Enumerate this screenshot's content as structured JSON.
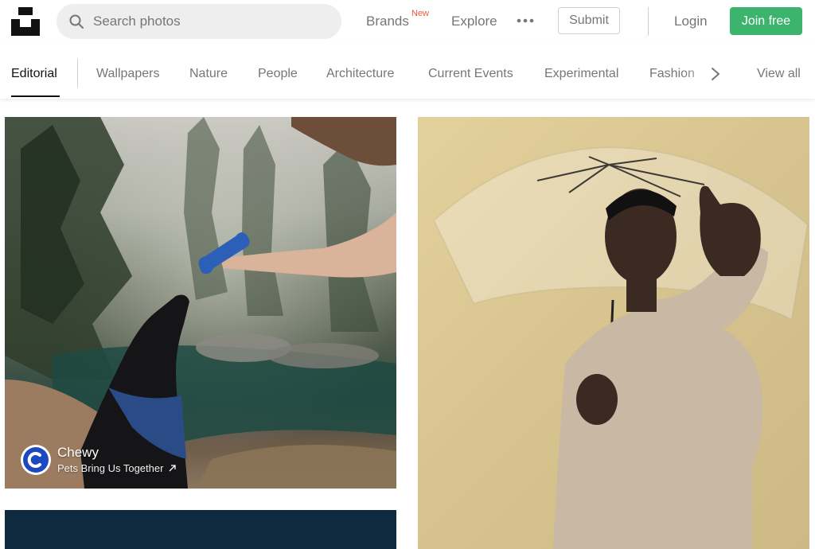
{
  "header": {
    "logo_icon": "unsplash-logo-icon",
    "search": {
      "placeholder": "Search photos",
      "icon": "search-icon"
    },
    "nav": {
      "brands": "Brands",
      "brands_badge": "New",
      "explore": "Explore",
      "more_icon": "more-dots-icon",
      "submit": "Submit",
      "login": "Login",
      "join": "Join free"
    },
    "colors": {
      "join_bg": "#3cb46e",
      "badge": "#e25c3d"
    }
  },
  "categories": {
    "items": [
      {
        "label": "Editorial",
        "active": true
      },
      {
        "label": "Wallpapers"
      },
      {
        "label": "Nature"
      },
      {
        "label": "People"
      },
      {
        "label": "Architecture"
      },
      {
        "label": "Current Events"
      },
      {
        "label": "Experimental"
      },
      {
        "label": "Fashion"
      }
    ],
    "next_icon": "chevron-right-icon",
    "view_all": "View all"
  },
  "photos": {
    "dog": {
      "subject": "dog-and-hand-with-toy-photo",
      "sponsor": {
        "name": "Chewy",
        "tagline": "Pets Bring Us Together",
        "avatar_letter": "C",
        "avatar_color": "#1c49c2",
        "link_icon": "external-arrow-icon"
      }
    },
    "man": {
      "subject": "man-with-clear-umbrella-photo"
    },
    "dark": {
      "subject": "dark-blue-photo"
    }
  }
}
